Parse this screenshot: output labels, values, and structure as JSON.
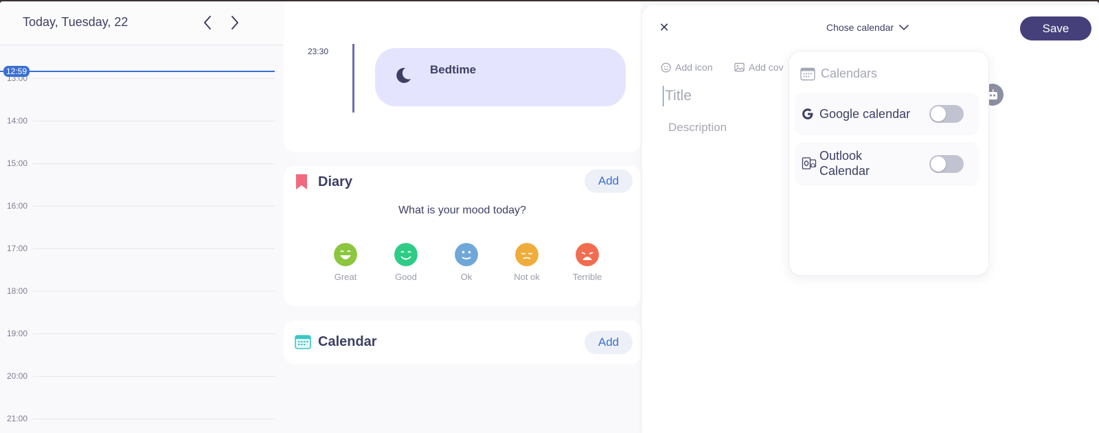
{
  "header": {
    "date_title": "Today, Tuesday, 22",
    "prev_icon": "chevron-left-icon",
    "next_icon": "chevron-right-icon"
  },
  "timeline": {
    "now_label": "12:59",
    "hours": [
      "13:00",
      "14:00",
      "15:00",
      "16:00",
      "17:00",
      "18:00",
      "19:00",
      "20:00",
      "21:00"
    ]
  },
  "sleep": {
    "time": "23:30",
    "event_label": "Bedtime",
    "event_icon": "moon-icon"
  },
  "diary": {
    "title": "Diary",
    "add_label": "Add",
    "question": "What is your mood today?",
    "moods": [
      {
        "label": "Great",
        "color": "#8dc63f"
      },
      {
        "label": "Good",
        "color": "#2ecc87"
      },
      {
        "label": "Ok",
        "color": "#6fa8d8"
      },
      {
        "label": "Not ok",
        "color": "#f0ac3a"
      },
      {
        "label": "Terrible",
        "color": "#f26c4f"
      }
    ]
  },
  "calendar_card": {
    "title": "Calendar",
    "add_label": "Add"
  },
  "panel": {
    "close_label": "✕",
    "chose_calendar_label": "Chose calendar",
    "save_label": "Save",
    "add_icon_label": "Add icon",
    "add_cover_label": "Add cov",
    "title_placeholder": "Title",
    "description_placeholder": "Description"
  },
  "dropdown": {
    "header": "Calendars",
    "items": [
      {
        "label": "Google calendar",
        "enabled": false
      },
      {
        "label_line1": "Outlook",
        "label_line2": "Calendar",
        "enabled": false
      }
    ]
  },
  "colors": {
    "accent_blue": "#3a6fd1",
    "save_button": "#45407a",
    "text_dark": "#3d3f63",
    "bedtime_bg": "#e4e4ff"
  }
}
